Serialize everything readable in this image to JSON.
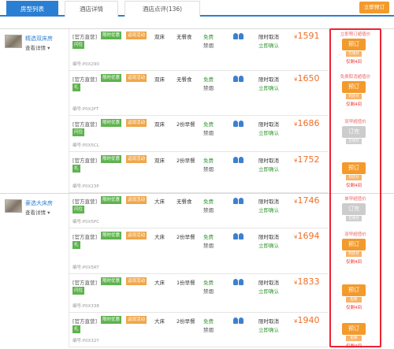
{
  "tabs": [
    {
      "label": "房型列表"
    },
    {
      "label": "酒店详情"
    },
    {
      "label": "酒店点评(136)"
    }
  ],
  "top_button": "立即预订",
  "rooms": [
    {
      "name": "精选双床房",
      "detail": "查看详情 ▾"
    },
    {
      "name": "豪选大床房",
      "detail": "查看详情 ▾"
    }
  ],
  "rates": [
    {
      "src": "[官方直营]",
      "b1": "限时优惠",
      "b2": "返现活动",
      "b3": "闪住",
      "code": "编号:P0X290",
      "bed": "双床",
      "meal": "无餐食",
      "free": "免费",
      "smoke": "禁烟",
      "cancel": "限时取消",
      "confirm": "立即确认",
      "price": "1591",
      "deal": "立即预订超值价",
      "btn": "预订",
      "pay": "在线付",
      "remain": "仅剩4间"
    },
    {
      "src": "[官方直营]",
      "b1": "限时优惠",
      "b2": "返现活动",
      "b3": "礼",
      "code": "编号:P0X2FT",
      "bed": "双床",
      "meal": "无餐食",
      "free": "免费",
      "smoke": "禁烟",
      "cancel": "限时取消",
      "confirm": "立即确认",
      "price": "1650",
      "deal": "免费取消超值价",
      "btn": "预订",
      "pay": "到店付",
      "remain": "仅剩4间"
    },
    {
      "src": "[官方直营]",
      "b1": "限时优惠",
      "b2": "返现活动",
      "b3": "闪住",
      "code": "编号:P0X5CL",
      "bed": "双床",
      "meal": "2份早餐",
      "free": "免费",
      "smoke": "禁烟",
      "cancel": "限时取消",
      "confirm": "立即确认",
      "price": "1686",
      "deal": "双早超值价",
      "btn": "订完",
      "pay": "在线付",
      "remain": ""
    },
    {
      "src": "[官方直营]",
      "b1": "限时优惠",
      "b2": "返现活动",
      "b3": "礼",
      "code": "编号:P0X23P",
      "bed": "双床",
      "meal": "2份早餐",
      "free": "免费",
      "smoke": "禁烟",
      "cancel": "限时取消",
      "confirm": "立即确认",
      "price": "1752",
      "deal": "",
      "btn": "预订",
      "pay": "到店付",
      "remain": "仅剩4间"
    },
    {
      "src": "[官方直营]",
      "b1": "限时优惠",
      "b2": "返现活动",
      "b3": "闪住",
      "code": "编号:P0X5PC",
      "bed": "大床",
      "meal": "无餐食",
      "free": "免费",
      "smoke": "禁烟",
      "cancel": "限时取消",
      "confirm": "立即确认",
      "price": "1746",
      "deal": "单早超值价",
      "btn": "订完",
      "pay": "在线付",
      "remain": ""
    },
    {
      "src": "[官方直营]",
      "b1": "限时优惠",
      "b2": "返现活动",
      "b3": "礼",
      "code": "编号:P0X5RT",
      "bed": "大床",
      "meal": "2份早餐",
      "free": "免费",
      "smoke": "禁烟",
      "cancel": "限时取消",
      "confirm": "立即确认",
      "price": "1694",
      "deal": "双早超值价",
      "btn": "预订",
      "pay": "到店付",
      "remain": "仅剩4间"
    },
    {
      "src": "[官方直营]",
      "b1": "限时优惠",
      "b2": "返现活动",
      "b3": "闪住",
      "code": "编号:P0X338",
      "bed": "大床",
      "meal": "1份早餐",
      "free": "免费",
      "smoke": "禁烟",
      "cancel": "限时取消",
      "confirm": "立即确认",
      "price": "1833",
      "deal": "",
      "btn": "预订",
      "pay": "担保",
      "remain": "仅剩4间"
    },
    {
      "src": "[官方直营]",
      "b1": "限时优惠",
      "b2": "返现活动",
      "b3": "礼",
      "code": "编号:P0X32Y",
      "bed": "大床",
      "meal": "2份早餐",
      "free": "免费",
      "smoke": "禁烟",
      "cancel": "限时取消",
      "confirm": "立即确认",
      "price": "1940",
      "deal": "",
      "btn": "预订",
      "pay": "担保",
      "remain": "仅剩4间"
    }
  ],
  "currency": "¥",
  "colors": {
    "accent": "#2b7fd3",
    "orange": "#f39a2c",
    "price": "#f06e26",
    "highlight": "#e22233"
  }
}
